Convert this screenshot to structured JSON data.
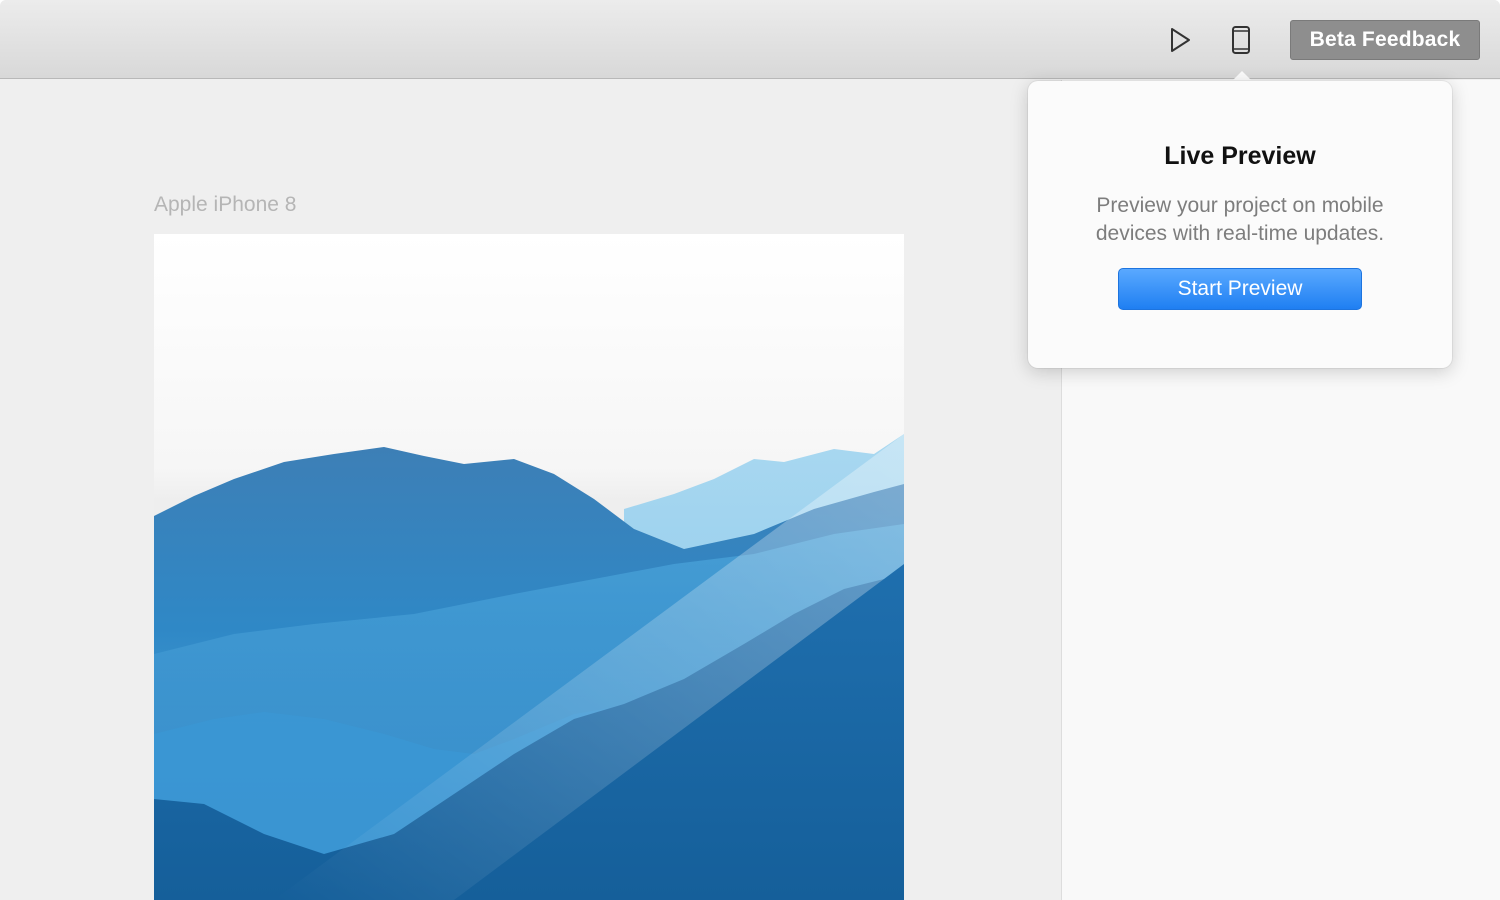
{
  "toolbar": {
    "icons": [
      "play-icon",
      "mobile-device-icon"
    ],
    "beta_feedback_label": "Beta Feedback"
  },
  "canvas": {
    "artboard_label": "Apple iPhone 8"
  },
  "popover": {
    "title": "Live Preview",
    "description": "Preview your project on mobile devices with real-time updates.",
    "start_button_label": "Start Preview"
  },
  "colors": {
    "accent": "#2a8af6",
    "beta_button_bg": "#8e8e8e",
    "toolbar_bg": "#dcdcdc",
    "canvas_bg": "#efefef"
  }
}
